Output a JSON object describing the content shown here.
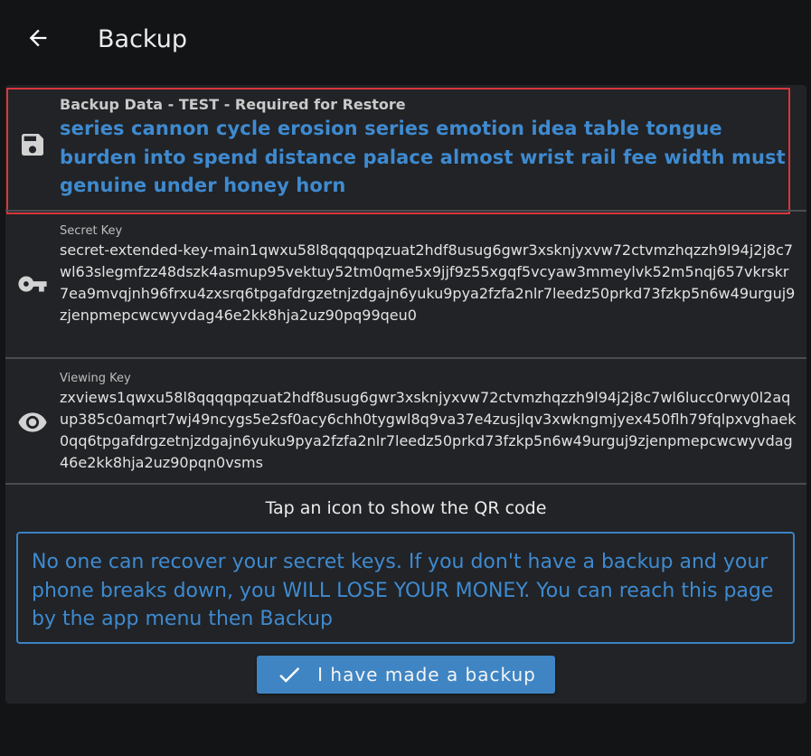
{
  "app_bar": {
    "title": "Backup",
    "back_icon": "arrow-left-icon"
  },
  "backup": {
    "label": "Backup Data - TEST - Required for Restore",
    "seed": "series cannon cycle erosion series emotion idea table tongue burden into spend distance palace almost wrist rail fee width must genuine under honey horn",
    "icon": "save-icon"
  },
  "secret_key": {
    "label": "Secret Key",
    "value": "secret-extended-key-main1qwxu58l8qqqqpqzuat2hdf8usug6gwr3xsknjyxvw72ctvmzhqzzh9l94j2j8c7wl63slegmfzz48dszk4asmup95vektuy52tm0qme5x9jjf9z55xgqf5vcyaw3mmeylvk52m5nqj657vkrskr7ea9mvqjnh96frxu4zxsrq6tpgafdrgzetnjzdgajn6yuku9pya2fzfa2nlr7leedz50prkd73fzkp5n6w49urguj9zjenpmepcwcwyvdag46e2kk8hja2uz90pq99qeu0",
    "icon": "key-icon"
  },
  "viewing_key": {
    "label": "Viewing Key",
    "value": "zxviews1qwxu58l8qqqqpqzuat2hdf8usug6gwr3xsknjyxvw72ctvmzhqzzh9l94j2j8c7wl6lucc0rwy0l2aqup385c0amqrt7wj49ncygs5e2sf0acy6chh0tygwl8q9va37e4zusjlqv3xwkngmjyex450flh79fqlpxvghaek0qq6tpgafdrgzetnjzdgajn6yuku9pya2fzfa2nlr7leedz50prkd73fzkp5n6w49urguj9zjenpmepcwcwyvdag46e2kk8hja2uz90pqn0vsms",
    "icon": "eye-icon"
  },
  "hint": "Tap an icon to show the QR code",
  "warning": "No one can recover your secret keys. If you don't have a backup and your phone breaks down, you WILL LOSE YOUR MONEY. You can reach this page by the app menu then Backup",
  "confirm_button": {
    "label": "I have made a backup",
    "icon": "check-icon"
  },
  "colors": {
    "background": "#131416",
    "card": "#212326",
    "accent": "#3f8ad0",
    "highlight": "#d8363c"
  }
}
